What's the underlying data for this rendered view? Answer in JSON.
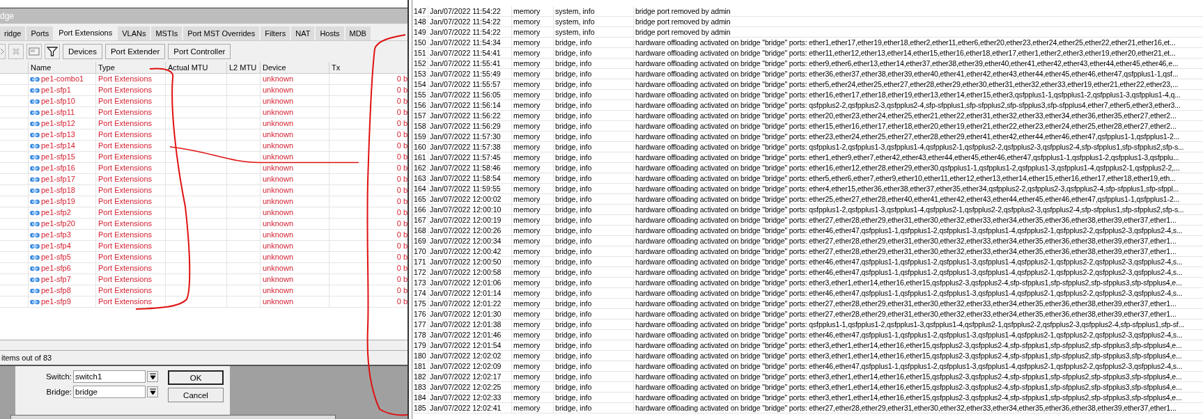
{
  "bridge_window": {
    "title": "dge",
    "tabs": [
      {
        "label": "ridge",
        "selected": false
      },
      {
        "label": "Ports",
        "selected": false
      },
      {
        "label": "Port Extensions",
        "selected": true
      },
      {
        "label": "VLANs",
        "selected": false
      },
      {
        "label": "MSTIs",
        "selected": false
      },
      {
        "label": "Port MST Overrides",
        "selected": false
      },
      {
        "label": "Filters",
        "selected": false
      },
      {
        "label": "NAT",
        "selected": false
      },
      {
        "label": "Hosts",
        "selected": false
      },
      {
        "label": "MDB",
        "selected": false
      }
    ],
    "toolbar_buttons": [
      "Devices",
      "Port Extender",
      "Port Controller"
    ],
    "table": {
      "columns": [
        "Name",
        "Type",
        "Actual MTU",
        "L2 MTU",
        "Device",
        "Tx"
      ],
      "rows": [
        {
          "name": "pe1-combo1",
          "type": "Port Extensions",
          "device": "unknown",
          "tx": "0 b"
        },
        {
          "name": "pe1-sfp1",
          "type": "Port Extensions",
          "device": "unknown",
          "tx": "0 b"
        },
        {
          "name": "pe1-sfp10",
          "type": "Port Extensions",
          "device": "unknown",
          "tx": "0 b"
        },
        {
          "name": "pe1-sfp11",
          "type": "Port Extensions",
          "device": "unknown",
          "tx": "0 b"
        },
        {
          "name": "pe1-sfp12",
          "type": "Port Extensions",
          "device": "unknown",
          "tx": "0 b"
        },
        {
          "name": "pe1-sfp13",
          "type": "Port Extensions",
          "device": "unknown",
          "tx": "0 b"
        },
        {
          "name": "pe1-sfp14",
          "type": "Port Extensions",
          "device": "unknown",
          "tx": "0 b"
        },
        {
          "name": "pe1-sfp15",
          "type": "Port Extensions",
          "device": "unknown",
          "tx": "0 b"
        },
        {
          "name": "pe1-sfp16",
          "type": "Port Extensions",
          "device": "unknown",
          "tx": "0 b"
        },
        {
          "name": "pe1-sfp17",
          "type": "Port Extensions",
          "device": "unknown",
          "tx": "0 b"
        },
        {
          "name": "pe1-sfp18",
          "type": "Port Extensions",
          "device": "unknown",
          "tx": "0 b"
        },
        {
          "name": "pe1-sfp19",
          "type": "Port Extensions",
          "device": "unknown",
          "tx": "0 b"
        },
        {
          "name": "pe1-sfp2",
          "type": "Port Extensions",
          "device": "unknown",
          "tx": "0 b"
        },
        {
          "name": "pe1-sfp20",
          "type": "Port Extensions",
          "device": "unknown",
          "tx": "0 b"
        },
        {
          "name": "pe1-sfp3",
          "type": "Port Extensions",
          "device": "unknown",
          "tx": "0 b"
        },
        {
          "name": "pe1-sfp4",
          "type": "Port Extensions",
          "device": "unknown",
          "tx": "0 b"
        },
        {
          "name": "pe1-sfp5",
          "type": "Port Extensions",
          "device": "unknown",
          "tx": "0 b"
        },
        {
          "name": "pe1-sfp6",
          "type": "Port Extensions",
          "device": "unknown",
          "tx": "0 b"
        },
        {
          "name": "pe1-sfp7",
          "type": "Port Extensions",
          "device": "unknown",
          "tx": "0 b"
        },
        {
          "name": "pe1-sfp8",
          "type": "Port Extensions",
          "device": "unknown",
          "tx": "0 b"
        },
        {
          "name": "pe1-sfp9",
          "type": "Port Extensions",
          "device": "unknown",
          "tx": "0 b"
        }
      ]
    },
    "status_bar": "items out of 83"
  },
  "dialog": {
    "fields": [
      {
        "label": "Switch:",
        "value": "switch1"
      },
      {
        "label": "Bridge:",
        "value": "bridge"
      }
    ],
    "buttons": [
      "OK",
      "Cancel"
    ]
  },
  "log": {
    "rows": [
      {
        "number": "147",
        "time": "Jan/07/2022 11:54:22",
        "buffer": "memory",
        "topics": "system, info",
        "message": "bridge port removed by admin"
      },
      {
        "number": "148",
        "time": "Jan/07/2022 11:54:22",
        "buffer": "memory",
        "topics": "system, info",
        "message": "bridge port removed by admin"
      },
      {
        "number": "149",
        "time": "Jan/07/2022 11:54:22",
        "buffer": "memory",
        "topics": "system, info",
        "message": "bridge port removed by admin"
      },
      {
        "number": "150",
        "time": "Jan/07/2022 11:54:34",
        "buffer": "memory",
        "topics": "bridge, info",
        "message": "hardware offloading activated on bridge \"bridge\" ports: ether1,ether17,ether19,ether18,ether2,ether11,ether6,ether20,ether23,ether24,ether25,ether22,ether21,ether16,et..."
      },
      {
        "number": "151",
        "time": "Jan/07/2022 11:54:41",
        "buffer": "memory",
        "topics": "bridge, info",
        "message": "hardware offloading activated on bridge \"bridge\" ports: ether11,ether12,ether13,ether14,ether15,ether16,ether18,ether17,ether1,ether2,ether3,ether19,ether20,ether21,et..."
      },
      {
        "number": "152",
        "time": "Jan/07/2022 11:55:41",
        "buffer": "memory",
        "topics": "bridge, info",
        "message": "hardware offloading activated on bridge \"bridge\" ports: ether9,ether6,ether13,ether14,ether37,ether38,ether39,ether40,ether41,ether42,ether43,ether44,ether45,ether46,e..."
      },
      {
        "number": "153",
        "time": "Jan/07/2022 11:55:49",
        "buffer": "memory",
        "topics": "bridge, info",
        "message": "hardware offloading activated on bridge \"bridge\" ports: ether36,ether37,ether38,ether39,ether40,ether41,ether42,ether43,ether44,ether45,ether46,ether47,qsfpplus1-1,qsf..."
      },
      {
        "number": "154",
        "time": "Jan/07/2022 11:55:57",
        "buffer": "memory",
        "topics": "bridge, info",
        "message": "hardware offloading activated on bridge \"bridge\" ports: ether5,ether24,ether25,ether27,ether28,ether29,ether30,ether31,ether32,ether33,ether19,ether21,ether22,ether23,..."
      },
      {
        "number": "155",
        "time": "Jan/07/2022 11:56:05",
        "buffer": "memory",
        "topics": "bridge, info",
        "message": "hardware offloading activated on bridge \"bridge\" ports: ether16,ether17,ether18,ether19,ether13,ether14,ether15,ether3,qsfpplus1-1,qsfpplus1-2,qsfpplus1-3,qsfpplus1-4,q..."
      },
      {
        "number": "156",
        "time": "Jan/07/2022 11:56:14",
        "buffer": "memory",
        "topics": "bridge, info",
        "message": "hardware offloading activated on bridge \"bridge\" ports: qsfpplus2-2,qsfpplus2-3,qsfpplus2-4,sfp-sfpplus1,sfp-sfpplus2,sfp-sfpplus3,sfp-sfpplus4,ether7,ether5,ether3,ether3..."
      },
      {
        "number": "157",
        "time": "Jan/07/2022 11:56:22",
        "buffer": "memory",
        "topics": "bridge, info",
        "message": "hardware offloading activated on bridge \"bridge\" ports: ether20,ether23,ether24,ether25,ether21,ether22,ether31,ether32,ether33,ether34,ether36,ether35,ether27,ether2..."
      },
      {
        "number": "158",
        "time": "Jan/07/2022 11:56:29",
        "buffer": "memory",
        "topics": "bridge, info",
        "message": "hardware offloading activated on bridge \"bridge\" ports: ether15,ether16,ether17,ether18,ether20,ether19,ether21,ether22,ether23,ether24,ether25,ether28,ether27,ether2..."
      },
      {
        "number": "159",
        "time": "Jan/07/2022 11:57:30",
        "buffer": "memory",
        "topics": "bridge, info",
        "message": "hardware offloading activated on bridge \"bridge\" ports: ether23,ether24,ether25,ether27,ether28,ether29,ether41,ether42,ether44,ether46,ether47,qsfpplus1-1,qsfpplus1-2..."
      },
      {
        "number": "160",
        "time": "Jan/07/2022 11:57:38",
        "buffer": "memory",
        "topics": "bridge, info",
        "message": "hardware offloading activated on bridge \"bridge\" ports: qsfpplus1-2,qsfpplus1-3,qsfpplus1-4,qsfpplus2-1,qsfpplus2-2,qsfpplus2-3,qsfpplus2-4,sfp-sfpplus1,sfp-sfpplus2,sfp-s..."
      },
      {
        "number": "161",
        "time": "Jan/07/2022 11:57:45",
        "buffer": "memory",
        "topics": "bridge, info",
        "message": "hardware offloading activated on bridge \"bridge\" ports: ether1,ether9,ether7,ether42,ether43,ether44,ether45,ether46,ether47,qsfpplus1-1,qsfpplus1-2,qsfpplus1-3,qsfpplu..."
      },
      {
        "number": "162",
        "time": "Jan/07/2022 11:58:46",
        "buffer": "memory",
        "topics": "bridge, info",
        "message": "hardware offloading activated on bridge \"bridge\" ports: ether16,ether12,ether28,ether29,ether30,qsfpplus1-1,qsfpplus1-2,qsfpplus1-3,qsfpplus1-4,qsfpplus2-1,qsfpplus2-2,..."
      },
      {
        "number": "163",
        "time": "Jan/07/2022 11:58:54",
        "buffer": "memory",
        "topics": "bridge, info",
        "message": "hardware offloading activated on bridge \"bridge\" ports: ether5,ether6,ether7,ether9,ether10,ether11,ether12,ether13,ether14,ether15,ether16,ether17,ether18,ether19,eth..."
      },
      {
        "number": "164",
        "time": "Jan/07/2022 11:59:55",
        "buffer": "memory",
        "topics": "bridge, info",
        "message": "hardware offloading activated on bridge \"bridge\" ports: ether4,ether15,ether36,ether38,ether37,ether35,ether34,qsfpplus2-2,qsfpplus2-3,qsfpplus2-4,sfp-sfpplus1,sfp-sfppl..."
      },
      {
        "number": "165",
        "time": "Jan/07/2022 12:00:02",
        "buffer": "memory",
        "topics": "bridge, info",
        "message": "hardware offloading activated on bridge \"bridge\" ports: ether25,ether27,ether28,ether40,ether41,ether42,ether43,ether44,ether45,ether46,ether47,qsfpplus1-1,qsfpplus1-2..."
      },
      {
        "number": "166",
        "time": "Jan/07/2022 12:00:10",
        "buffer": "memory",
        "topics": "bridge, info",
        "message": "hardware offloading activated on bridge \"bridge\" ports: qsfpplus1-2,qsfpplus1-3,qsfpplus1-4,qsfpplus2-1,qsfpplus2-2,qsfpplus2-3,qsfpplus2-4,sfp-sfpplus1,sfp-sfpplus2,sfp-s..."
      },
      {
        "number": "167",
        "time": "Jan/07/2022 12:00:19",
        "buffer": "memory",
        "topics": "bridge, info",
        "message": "hardware offloading activated on bridge \"bridge\" ports: ether27,ether28,ether29,ether31,ether30,ether32,ether33,ether34,ether35,ether36,ether38,ether39,ether37,ether1..."
      },
      {
        "number": "168",
        "time": "Jan/07/2022 12:00:26",
        "buffer": "memory",
        "topics": "bridge, info",
        "message": "hardware offloading activated on bridge \"bridge\" ports: ether46,ether47,qsfpplus1-1,qsfpplus1-2,qsfpplus1-3,qsfpplus1-4,qsfpplus2-1,qsfpplus2-2,qsfpplus2-3,qsfpplus2-4,s..."
      },
      {
        "number": "169",
        "time": "Jan/07/2022 12:00:34",
        "buffer": "memory",
        "topics": "bridge, info",
        "message": "hardware offloading activated on bridge \"bridge\" ports: ether27,ether28,ether29,ether31,ether30,ether32,ether33,ether34,ether35,ether36,ether38,ether39,ether37,ether1..."
      },
      {
        "number": "170",
        "time": "Jan/07/2022 12:00:42",
        "buffer": "memory",
        "topics": "bridge, info",
        "message": "hardware offloading activated on bridge \"bridge\" ports: ether27,ether28,ether29,ether31,ether30,ether32,ether33,ether34,ether35,ether36,ether38,ether39,ether37,ether1..."
      },
      {
        "number": "171",
        "time": "Jan/07/2022 12:00:50",
        "buffer": "memory",
        "topics": "bridge, info",
        "message": "hardware offloading activated on bridge \"bridge\" ports: ether46,ether47,qsfpplus1-1,qsfpplus1-2,qsfpplus1-3,qsfpplus1-4,qsfpplus2-1,qsfpplus2-2,qsfpplus2-3,qsfpplus2-4,s..."
      },
      {
        "number": "172",
        "time": "Jan/07/2022 12:00:58",
        "buffer": "memory",
        "topics": "bridge, info",
        "message": "hardware offloading activated on bridge \"bridge\" ports: ether46,ether47,qsfpplus1-1,qsfpplus1-2,qsfpplus1-3,qsfpplus1-4,qsfpplus2-1,qsfpplus2-2,qsfpplus2-3,qsfpplus2-4,s..."
      },
      {
        "number": "173",
        "time": "Jan/07/2022 12:01:06",
        "buffer": "memory",
        "topics": "bridge, info",
        "message": "hardware offloading activated on bridge \"bridge\" ports: ether3,ether1,ether14,ether16,ether15,qsfpplus2-3,qsfpplus2-4,sfp-sfpplus1,sfp-sfpplus2,sfp-sfpplus3,sfp-sfpplus4,e..."
      },
      {
        "number": "174",
        "time": "Jan/07/2022 12:01:14",
        "buffer": "memory",
        "topics": "bridge, info",
        "message": "hardware offloading activated on bridge \"bridge\" ports: ether46,ether47,qsfpplus1-1,qsfpplus1-2,qsfpplus1-3,qsfpplus1-4,qsfpplus2-1,qsfpplus2-2,qsfpplus2-3,qsfpplus2-4,s..."
      },
      {
        "number": "175",
        "time": "Jan/07/2022 12:01:22",
        "buffer": "memory",
        "topics": "bridge, info",
        "message": "hardware offloading activated on bridge \"bridge\" ports: ether27,ether28,ether29,ether31,ether30,ether32,ether33,ether34,ether35,ether36,ether38,ether39,ether37,ether1..."
      },
      {
        "number": "176",
        "time": "Jan/07/2022 12:01:30",
        "buffer": "memory",
        "topics": "bridge, info",
        "message": "hardware offloading activated on bridge \"bridge\" ports: ether27,ether28,ether29,ether31,ether30,ether32,ether33,ether34,ether35,ether36,ether38,ether39,ether37,ether1..."
      },
      {
        "number": "177",
        "time": "Jan/07/2022 12:01:38",
        "buffer": "memory",
        "topics": "bridge, info",
        "message": "hardware offloading activated on bridge \"bridge\" ports: qsfpplus1-1,qsfpplus1-2,qsfpplus1-3,qsfpplus1-4,qsfpplus2-1,qsfpplus2-2,qsfpplus2-3,qsfpplus2-4,sfp-sfpplus1,sfp-sf..."
      },
      {
        "number": "178",
        "time": "Jan/07/2022 12:01:46",
        "buffer": "memory",
        "topics": "bridge, info",
        "message": "hardware offloading activated on bridge \"bridge\" ports: ether46,ether47,qsfpplus1-1,qsfpplus1-2,qsfpplus1-3,qsfpplus1-4,qsfpplus2-1,qsfpplus2-2,qsfpplus2-3,qsfpplus2-4,s..."
      },
      {
        "number": "179",
        "time": "Jan/07/2022 12:01:54",
        "buffer": "memory",
        "topics": "bridge, info",
        "message": "hardware offloading activated on bridge \"bridge\" ports: ether3,ether1,ether14,ether16,ether15,qsfpplus2-3,qsfpplus2-4,sfp-sfpplus1,sfp-sfpplus2,sfp-sfpplus3,sfp-sfpplus4,e..."
      },
      {
        "number": "180",
        "time": "Jan/07/2022 12:02:02",
        "buffer": "memory",
        "topics": "bridge, info",
        "message": "hardware offloading activated on bridge \"bridge\" ports: ether3,ether1,ether14,ether16,ether15,qsfpplus2-3,qsfpplus2-4,sfp-sfpplus1,sfp-sfpplus2,sfp-sfpplus3,sfp-sfpplus4,e..."
      },
      {
        "number": "181",
        "time": "Jan/07/2022 12:02:09",
        "buffer": "memory",
        "topics": "bridge, info",
        "message": "hardware offloading activated on bridge \"bridge\" ports: ether46,ether47,qsfpplus1-1,qsfpplus1-2,qsfpplus1-3,qsfpplus1-4,qsfpplus2-1,qsfpplus2-2,qsfpplus2-3,qsfpplus2-4,s..."
      },
      {
        "number": "182",
        "time": "Jan/07/2022 12:02:17",
        "buffer": "memory",
        "topics": "bridge, info",
        "message": "hardware offloading activated on bridge \"bridge\" ports: ether3,ether1,ether14,ether16,ether15,qsfpplus2-3,qsfpplus2-4,sfp-sfpplus1,sfp-sfpplus2,sfp-sfpplus3,sfp-sfpplus4,e..."
      },
      {
        "number": "183",
        "time": "Jan/07/2022 12:02:25",
        "buffer": "memory",
        "topics": "bridge, info",
        "message": "hardware offloading activated on bridge \"bridge\" ports: ether3,ether1,ether14,ether16,ether15,qsfpplus2-3,qsfpplus2-4,sfp-sfpplus1,sfp-sfpplus2,sfp-sfpplus3,sfp-sfpplus4,e..."
      },
      {
        "number": "184",
        "time": "Jan/07/2022 12:02:33",
        "buffer": "memory",
        "topics": "bridge, info",
        "message": "hardware offloading activated on bridge \"bridge\" ports: ether3,ether1,ether14,ether16,ether15,qsfpplus2-3,qsfpplus2-4,sfp-sfpplus1,sfp-sfpplus2,sfp-sfpplus3,sfp-sfpplus4,e..."
      },
      {
        "number": "185",
        "time": "Jan/07/2022 12:02:41",
        "buffer": "memory",
        "topics": "bridge, info",
        "message": "hardware offloading activated on bridge \"bridge\" ports: ether27,ether28,ether29,ether31,ether30,ether32,ether33,ether34,ether35,ether36,ether38,ether39,ether37,ether1..."
      }
    ]
  }
}
